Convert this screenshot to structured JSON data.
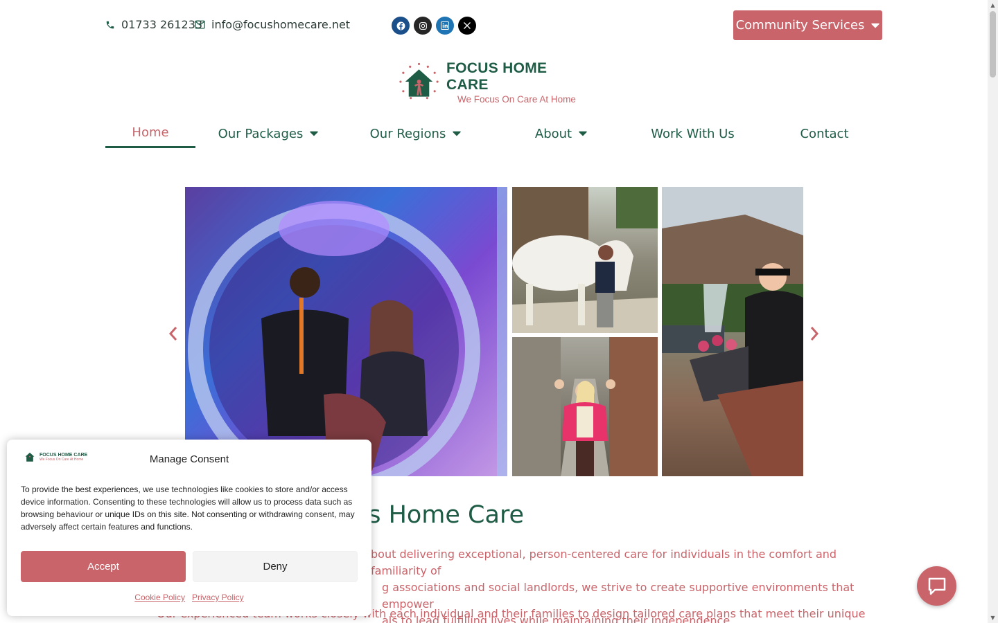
{
  "topbar": {
    "phone": "01733 261233",
    "email": "info@focushomecare.net",
    "socials": [
      "facebook-icon",
      "instagram-icon",
      "linkedin-icon",
      "x-icon"
    ],
    "community_button": "Community Services"
  },
  "logo": {
    "name": "FOCUS HOME CARE",
    "tagline": "We Focus On Care At Home"
  },
  "nav": {
    "items": [
      {
        "label": "Home",
        "active": true
      },
      {
        "label": "Our Packages",
        "dropdown": true
      },
      {
        "label": "Our Regions",
        "dropdown": true
      },
      {
        "label": "About",
        "dropdown": true
      },
      {
        "label": "Work With Us"
      },
      {
        "label": "Contact"
      }
    ]
  },
  "main": {
    "welcome_title": "Welcome to Focus Home Care",
    "para1_lines": [
      "bout delivering exceptional, person-centered care for individuals in the comfort and familiarity of",
      "g associations and social landlords, we strive to create supportive environments that empower",
      "als to lead fulfilling lives while maintaining their independence."
    ],
    "para2": "Our experienced team works closely with each individual and their families to design tailored care plans that meet their unique needs and"
  },
  "consent": {
    "title": "Manage Consent",
    "logo_name": "FOCUS HOME CARE",
    "logo_tagline": "We Focus On Care At Home",
    "text": "To provide the best experiences, we use technologies like cookies to store and/or access device information. Consenting to these technologies will allow us to process data such as browsing behaviour or unique IDs on this site. Not consenting or withdrawing consent, may adversely affect certain features and functions.",
    "accept": "Accept",
    "deny": "Deny",
    "cookie_policy": "Cookie Policy",
    "privacy_policy": "Privacy Policy"
  },
  "colors": {
    "brand_green": "#1f5c46",
    "brand_rose": "#c8646a"
  }
}
